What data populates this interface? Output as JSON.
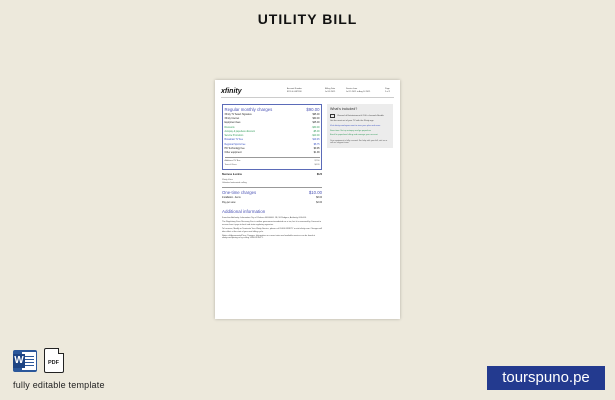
{
  "page": {
    "title": "UTILITY BILL",
    "caption": "fully editable template",
    "brand": "tourspuno.pe",
    "file_icons": {
      "word_letter": "W",
      "pdf_label": "PDF"
    }
  },
  "bill": {
    "logo": "xfinity",
    "header_cols": [
      {
        "label": "Account Number",
        "value": "8155 4 0487998"
      },
      {
        "label": "Billing Date",
        "value": "Jul 09 2021"
      },
      {
        "label": "Service from",
        "value": "Jul 15 2021 to Aug 14 2021"
      },
      {
        "label": "Page",
        "value": "2 of 2"
      }
    ],
    "regular": {
      "title": "Regular monthly charges",
      "total": "$90.00",
      "rows": [
        {
          "label": "Xfinity TV Select Signature",
          "value": "$95.00",
          "style": ""
        },
        {
          "label": "Xfinity Internet",
          "value": "$60.00",
          "style": ""
        },
        {
          "label": "Equipment fees",
          "value": "$45.00",
          "style": ""
        },
        {
          "label": "Discounts",
          "value": "-$30.00",
          "style": "green"
        },
        {
          "label": "Autopay & paperless discount",
          "value": "-$5.00",
          "style": "green"
        },
        {
          "label": "Service Promotion",
          "value": "-$10.00",
          "style": "green"
        },
        {
          "label": "Broadcast TV Fee",
          "value": "$19.45",
          "style": "blue"
        },
        {
          "label": "Regional Sports Fee",
          "value": "$8.75",
          "style": "blue"
        },
        {
          "label": "HD Technology Fee",
          "value": "$9.95",
          "style": ""
        },
        {
          "label": "Other equipment",
          "value": "$1.99",
          "style": ""
        }
      ],
      "sub_rows": [
        {
          "label": "Additional TV Box",
          "value": "$7.50"
        },
        {
          "label": "Taxes & Fees",
          "value": "$4.20"
        }
      ]
    },
    "business": {
      "title": "Business & extras",
      "amount": "$120",
      "note": "Xfinity Voice",
      "sub": "Unlimited nationwide calling"
    },
    "onetime": {
      "title": "One-time charges",
      "total": "$10.00",
      "rows": [
        {
          "label": "Installation - Items",
          "value": "$8.00"
        },
        {
          "label": "Pay-per-view",
          "value": "$2.00"
        }
      ]
    },
    "info": {
      "title": "Additional information",
      "paragraphs": [
        "Franchise Authority: Information City of Chelsea 00000000. 1B, 96 Rodgers, Authority, 000-000.",
        "The Regulatory Fees Recovery Fee is neither government-mandated nor a tax, but it is assessed by Comcast to recover fees it pays to local and state regulatory agencies.",
        "To Increase, Modify or Terminate Your Xfinity Service, please call 1-800-XFINITY or visit xfinity.com. Changes will take effect at the start of your next billing cycle.",
        "Notice of Agreements/Price Changes: Information on current rates and available services can be found at xfinity.com/pricing or by calling 1-800-XFINITY."
      ]
    },
    "whats_included": {
      "title": "What's included?",
      "rows": [
        {
          "label": "Channel of Entertainment & 100+ channels Bundle",
          "style": ""
        },
        {
          "label": "Get the most out of your TV with the Xfinity app",
          "style": ""
        },
        {
          "label": "Visit xfinity.com/myaccount to view your plan and more",
          "style": "blue"
        },
        {
          "label": "Save time: Set up autopay and go paperless",
          "style": "green"
        },
        {
          "label": "Enroll in paperless billing and manage your account",
          "style": "green"
        }
      ],
      "note": "Your equipment is fully covered. For help with your bill, visit us or call our support team."
    }
  }
}
